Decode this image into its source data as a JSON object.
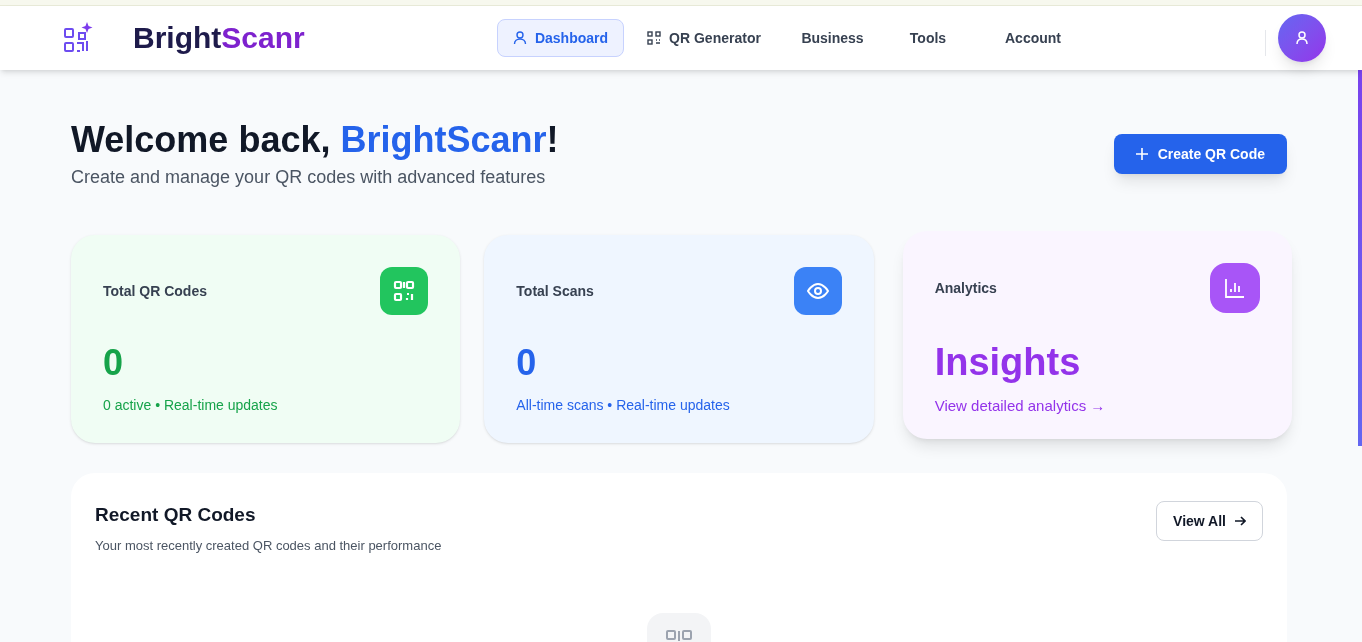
{
  "brand": {
    "name_dark": "Bright",
    "name_light": "Scanr"
  },
  "nav": [
    {
      "label": "Dashboard",
      "selected": true
    },
    {
      "label": "QR Generator",
      "selected": false
    },
    {
      "label": "Business",
      "selected": false
    },
    {
      "label": "Tools",
      "selected": false
    },
    {
      "label": "Account",
      "selected": false
    }
  ],
  "welcome": {
    "title_start": "Welcome back, ",
    "title_highlight": "BrightScanr",
    "title_end": "!",
    "subtitle": "Create and manage your QR codes with advanced features"
  },
  "create_button": {
    "label": "Create QR Code"
  },
  "stats": [
    {
      "kind": "qr",
      "title": "Total QR Codes",
      "value": "0",
      "note": "0 active • Real-time updates"
    },
    {
      "kind": "scans",
      "title": "Total Scans",
      "value": "0",
      "note": "All-time scans • Real-time updates"
    },
    {
      "kind": "analytics",
      "title": "Analytics",
      "value": "Insights",
      "note": "View detailed analytics →"
    }
  ],
  "recent": {
    "title": "Recent QR Codes",
    "subtitle": "Your most recently created QR codes and their performance",
    "view_all": "View All"
  }
}
